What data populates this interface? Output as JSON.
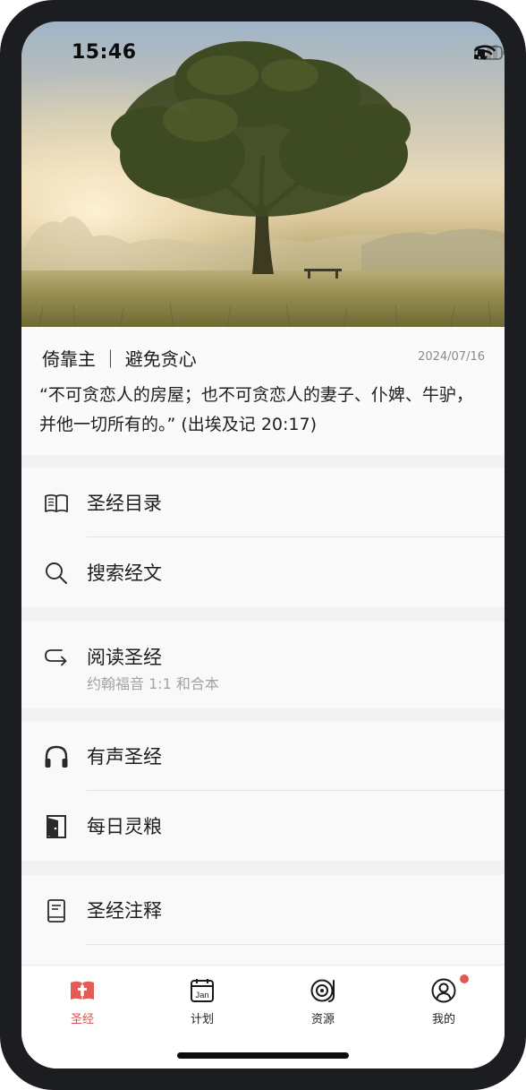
{
  "status_bar": {
    "time": "15:46",
    "icons": [
      "cellular-signal-icon",
      "wifi-icon",
      "battery-icon"
    ]
  },
  "hero": {
    "image": "tree-in-misty-meadow"
  },
  "verse": {
    "title": "倚靠主 ｜ 避免贪心",
    "date": "2024/07/16",
    "text": "“不可贪恋人的房屋；也不可贪恋人的妻子、仆婢、牛驴，并他一切所有的。” (出埃及记 20:17)"
  },
  "menu": {
    "group1": [
      {
        "label": "圣经目录",
        "icon": "open-book-icon"
      },
      {
        "label": "搜索经文",
        "icon": "search-icon"
      }
    ],
    "group2": [
      {
        "label": "阅读圣经",
        "sublabel": "约翰福音 1:1 和合本",
        "icon": "return-arrow-icon"
      }
    ],
    "group3": [
      {
        "label": "有声圣经",
        "icon": "headphones-icon"
      },
      {
        "label": "每日灵粮",
        "icon": "door-icon"
      }
    ],
    "group4": [
      {
        "label": "圣经注释",
        "icon": "notebook-icon"
      }
    ]
  },
  "tabbar": {
    "tabs": [
      {
        "label": "圣经",
        "icon": "bible-icon",
        "active": true
      },
      {
        "label": "计划",
        "icon": "calendar-icon",
        "icon_text": "Jan"
      },
      {
        "label": "资源",
        "icon": "vinyl-record-icon"
      },
      {
        "label": "我的",
        "icon": "profile-icon",
        "badge": true
      }
    ]
  },
  "colors": {
    "accent": "#d9534f",
    "background": "#f2f2f4",
    "card": "#f9f9fa",
    "text": "#1d1d1d",
    "secondary_text": "#a3a3a3",
    "frame": "#1c1d20"
  }
}
